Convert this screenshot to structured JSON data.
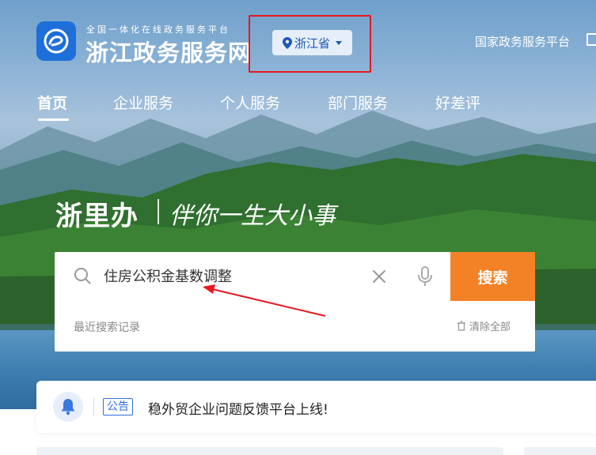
{
  "header": {
    "site_subtitle": "全国一体化在线政务服务平台",
    "site_title": "浙江政务服务网",
    "region": "浙江省",
    "national_link": "国家政务服务平台"
  },
  "nav": {
    "items": [
      {
        "label": "首页",
        "active": true
      },
      {
        "label": "企业服务",
        "active": false
      },
      {
        "label": "个人服务",
        "active": false
      },
      {
        "label": "部门服务",
        "active": false
      },
      {
        "label": "好差评",
        "active": false
      }
    ]
  },
  "slogan": {
    "main": "浙里办",
    "sub": "伴你一生大小事"
  },
  "search": {
    "query": "住房公积金基数调整",
    "button_label": "搜索",
    "recent_label": "最近搜索记录",
    "clear_all_label": "清除全部"
  },
  "notice": {
    "badge": "公告",
    "text": "稳外贸企业问题反馈平台上线!"
  },
  "colors": {
    "accent_orange": "#f38227",
    "brand_blue": "#1e6fd9",
    "annotation_red": "#e8161e"
  }
}
